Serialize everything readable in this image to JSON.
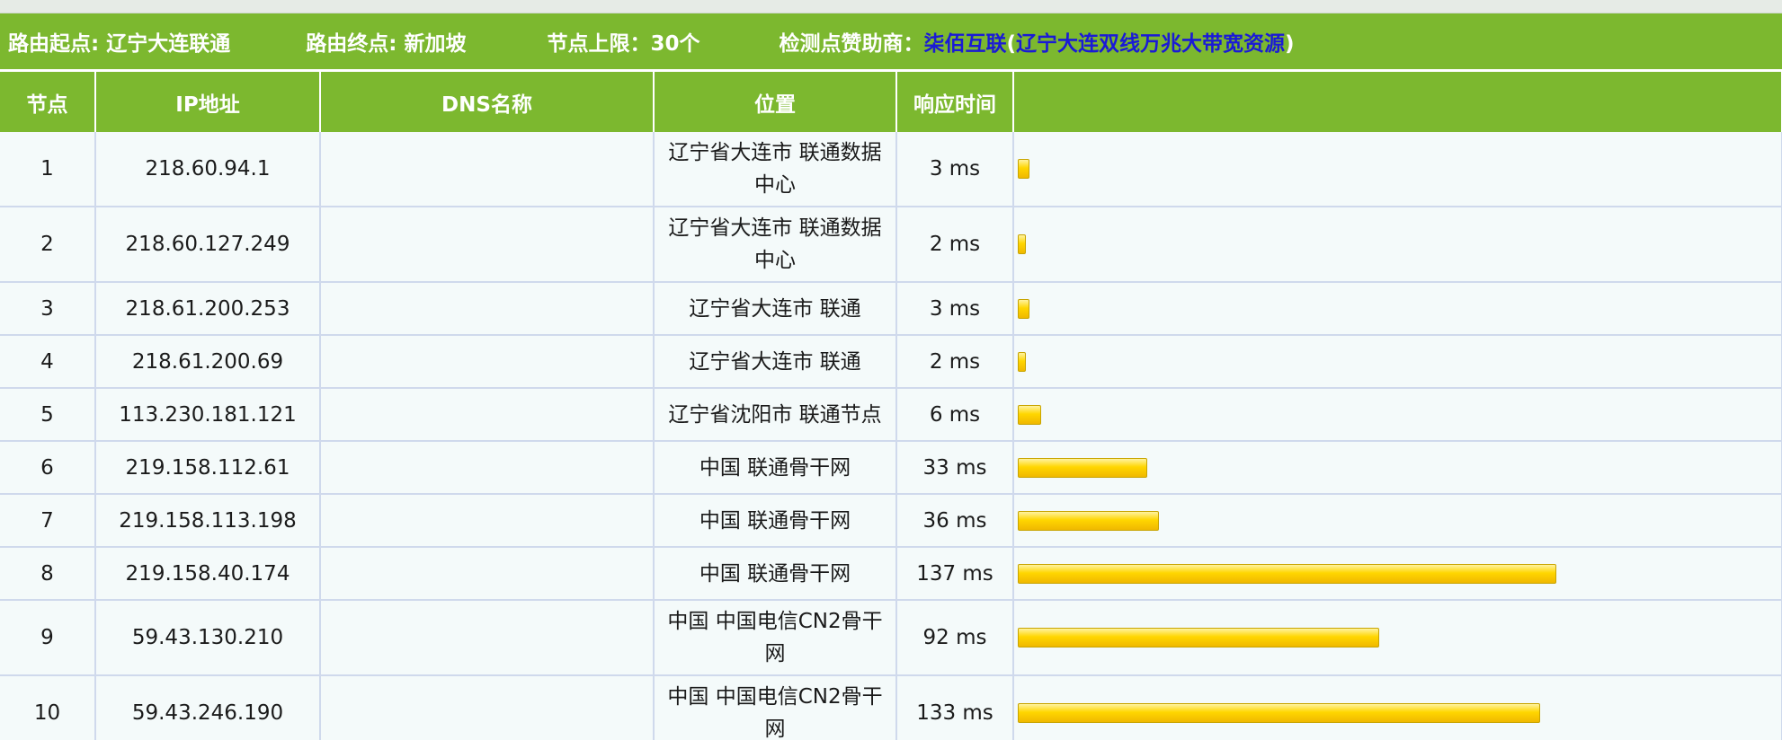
{
  "route": {
    "start_label": "路由起点:",
    "start_value": "辽宁大连联通",
    "end_label": "路由终点:",
    "end_value": "新加坡",
    "limit_label": "节点上限：",
    "limit_value": "30个",
    "sponsor_label": "检测点赞助商：",
    "sponsor_name": "柒佰互联",
    "sponsor_open": "(",
    "sponsor_detail": "辽宁大连双线万兆大带宽资源",
    "sponsor_close": ")"
  },
  "table": {
    "headers": {
      "node": "节点",
      "ip": "IP地址",
      "dns": "DNS名称",
      "location": "位置",
      "time": "响应时间",
      "bar": ""
    },
    "rows": [
      {
        "node": "1",
        "ip": "218.60.94.1",
        "dns": "",
        "location": "辽宁省大连市 联通数据中心",
        "time": "3 ms",
        "ms": 3
      },
      {
        "node": "2",
        "ip": "218.60.127.249",
        "dns": "",
        "location": "辽宁省大连市 联通数据中心",
        "time": "2 ms",
        "ms": 2
      },
      {
        "node": "3",
        "ip": "218.61.200.253",
        "dns": "",
        "location": "辽宁省大连市 联通",
        "time": "3 ms",
        "ms": 3
      },
      {
        "node": "4",
        "ip": "218.61.200.69",
        "dns": "",
        "location": "辽宁省大连市 联通",
        "time": "2 ms",
        "ms": 2
      },
      {
        "node": "5",
        "ip": "113.230.181.121",
        "dns": "",
        "location": "辽宁省沈阳市 联通节点",
        "time": "6 ms",
        "ms": 6
      },
      {
        "node": "6",
        "ip": "219.158.112.61",
        "dns": "",
        "location": "中国 联通骨干网",
        "time": "33 ms",
        "ms": 33
      },
      {
        "node": "7",
        "ip": "219.158.113.198",
        "dns": "",
        "location": "中国 联通骨干网",
        "time": "36 ms",
        "ms": 36
      },
      {
        "node": "8",
        "ip": "219.158.40.174",
        "dns": "",
        "location": "中国 联通骨干网",
        "time": "137 ms",
        "ms": 137
      },
      {
        "node": "9",
        "ip": "59.43.130.210",
        "dns": "",
        "location": "中国 中国电信CN2骨干网",
        "time": "92 ms",
        "ms": 92
      },
      {
        "node": "10",
        "ip": "59.43.246.190",
        "dns": "",
        "location": "中国 中国电信CN2骨干网",
        "time": "133 ms",
        "ms": 133
      }
    ]
  },
  "colors": {
    "header_green": "#7cb82f",
    "link_blue": "#1a1ad6",
    "bar_yellow": "#ffd600",
    "row_bg": "#f4fafa"
  }
}
